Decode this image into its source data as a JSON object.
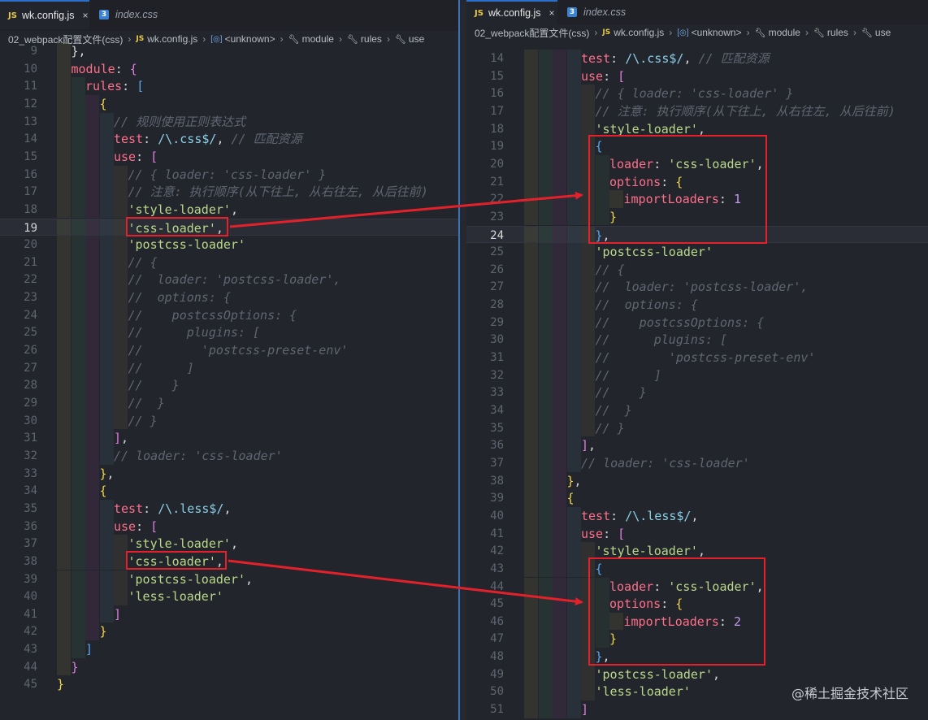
{
  "left": {
    "tabs": [
      {
        "icon": "JS",
        "label": "wk.config.js",
        "active": true,
        "close": "×"
      },
      {
        "icon": "css",
        "label": "index.css",
        "active": false
      }
    ],
    "breadcrumb": [
      "02_webpack配置文件(css)",
      "wk.config.js",
      "<unknown>",
      "module",
      "rules",
      "use"
    ],
    "lines": [
      {
        "n": "9",
        "ind": 1,
        "t": [
          [
            "},",
            "t-p"
          ]
        ]
      },
      {
        "n": "10",
        "ind": 1,
        "t": [
          [
            "module",
            "t-key"
          ],
          [
            ": ",
            "t-p"
          ],
          [
            "{",
            "t-b2"
          ]
        ]
      },
      {
        "n": "11",
        "ind": 2,
        "t": [
          [
            "rules",
            "t-key"
          ],
          [
            ": ",
            "t-p"
          ],
          [
            "[",
            "t-b3"
          ]
        ]
      },
      {
        "n": "12",
        "ind": 3,
        "t": [
          [
            "{",
            "t-b1"
          ]
        ]
      },
      {
        "n": "13",
        "ind": 4,
        "t": [
          [
            "// 规则使用正则表达式",
            "t-cmt"
          ]
        ]
      },
      {
        "n": "14",
        "ind": 4,
        "t": [
          [
            "test",
            "t-key"
          ],
          [
            ": ",
            "t-p"
          ],
          [
            "/\\.css$/",
            "t-reg"
          ],
          [
            ", ",
            "t-p"
          ],
          [
            "// 匹配资源",
            "t-cmt"
          ]
        ]
      },
      {
        "n": "15",
        "ind": 4,
        "t": [
          [
            "use",
            "t-key"
          ],
          [
            ": ",
            "t-p"
          ],
          [
            "[",
            "t-b2"
          ]
        ]
      },
      {
        "n": "16",
        "ind": 5,
        "t": [
          [
            "// { loader: 'css-loader' }",
            "t-cmt"
          ]
        ]
      },
      {
        "n": "17",
        "ind": 5,
        "t": [
          [
            "// 注意: 执行顺序(从下往上, 从右往左, 从后往前)",
            "t-cmt"
          ]
        ]
      },
      {
        "n": "18",
        "ind": 5,
        "t": [
          [
            "'style-loader'",
            "t-str"
          ],
          [
            ",",
            "t-p"
          ]
        ]
      },
      {
        "n": "19",
        "ind": 5,
        "cur": true,
        "t": [
          [
            "'css-loader'",
            "t-str"
          ],
          [
            ",",
            "t-p"
          ]
        ]
      },
      {
        "n": "20",
        "ind": 5,
        "t": [
          [
            "'postcss-loader'",
            "t-str"
          ]
        ]
      },
      {
        "n": "21",
        "ind": 5,
        "t": [
          [
            "// {",
            "t-cmt"
          ]
        ]
      },
      {
        "n": "22",
        "ind": 5,
        "t": [
          [
            "//  loader: 'postcss-loader',",
            "t-cmt"
          ]
        ]
      },
      {
        "n": "23",
        "ind": 5,
        "t": [
          [
            "//  options: {",
            "t-cmt"
          ]
        ]
      },
      {
        "n": "24",
        "ind": 5,
        "t": [
          [
            "//    postcssOptions: {",
            "t-cmt"
          ]
        ]
      },
      {
        "n": "25",
        "ind": 5,
        "t": [
          [
            "//      plugins: [",
            "t-cmt"
          ]
        ]
      },
      {
        "n": "26",
        "ind": 5,
        "t": [
          [
            "//        'postcss-preset-env'",
            "t-cmt"
          ]
        ]
      },
      {
        "n": "27",
        "ind": 5,
        "t": [
          [
            "//      ]",
            "t-cmt"
          ]
        ]
      },
      {
        "n": "28",
        "ind": 5,
        "t": [
          [
            "//    }",
            "t-cmt"
          ]
        ]
      },
      {
        "n": "29",
        "ind": 5,
        "t": [
          [
            "//  }",
            "t-cmt"
          ]
        ]
      },
      {
        "n": "30",
        "ind": 5,
        "t": [
          [
            "// }",
            "t-cmt"
          ]
        ]
      },
      {
        "n": "31",
        "ind": 4,
        "t": [
          [
            "]",
            "t-b2"
          ],
          [
            ",",
            "t-p"
          ]
        ]
      },
      {
        "n": "32",
        "ind": 4,
        "t": [
          [
            "// loader: 'css-loader'",
            "t-cmt"
          ]
        ]
      },
      {
        "n": "33",
        "ind": 3,
        "t": [
          [
            "}",
            "t-b1"
          ],
          [
            ",",
            "t-p"
          ]
        ]
      },
      {
        "n": "34",
        "ind": 3,
        "t": [
          [
            "{",
            "t-b1"
          ]
        ]
      },
      {
        "n": "35",
        "ind": 4,
        "t": [
          [
            "test",
            "t-key"
          ],
          [
            ": ",
            "t-p"
          ],
          [
            "/\\.less$/",
            "t-reg"
          ],
          [
            ",",
            "t-p"
          ]
        ]
      },
      {
        "n": "36",
        "ind": 4,
        "t": [
          [
            "use",
            "t-key"
          ],
          [
            ": ",
            "t-p"
          ],
          [
            "[",
            "t-b2"
          ]
        ]
      },
      {
        "n": "37",
        "ind": 5,
        "t": [
          [
            "'style-loader'",
            "t-str"
          ],
          [
            ",",
            "t-p"
          ]
        ]
      },
      {
        "n": "38",
        "ind": 5,
        "t": [
          [
            "'css-loader'",
            "t-str"
          ],
          [
            ",",
            "t-p"
          ]
        ]
      },
      {
        "n": "39",
        "ind": 5,
        "t": [
          [
            "'postcss-loader'",
            "t-str"
          ],
          [
            ",",
            "t-p"
          ]
        ]
      },
      {
        "n": "40",
        "ind": 5,
        "t": [
          [
            "'less-loader'",
            "t-str"
          ]
        ]
      },
      {
        "n": "41",
        "ind": 4,
        "t": [
          [
            "]",
            "t-b2"
          ]
        ]
      },
      {
        "n": "42",
        "ind": 3,
        "t": [
          [
            "}",
            "t-b1"
          ]
        ]
      },
      {
        "n": "43",
        "ind": 2,
        "t": [
          [
            "]",
            "t-b3"
          ]
        ]
      },
      {
        "n": "44",
        "ind": 1,
        "t": [
          [
            "}",
            "t-b2"
          ]
        ]
      },
      {
        "n": "45",
        "ind": 0,
        "t": [
          [
            "}",
            "t-b1"
          ]
        ]
      }
    ]
  },
  "right": {
    "tabs": [
      {
        "icon": "JS",
        "label": "wk.config.js",
        "active": true,
        "close": "×"
      },
      {
        "icon": "css",
        "label": "index.css",
        "active": false
      }
    ],
    "breadcrumb": [
      "02_webpack配置文件(css)",
      "wk.config.js",
      "<unknown>",
      "module",
      "rules",
      "use"
    ],
    "lines": [
      {
        "n": "14",
        "ind": 4,
        "t": [
          [
            "test",
            "t-key"
          ],
          [
            ": ",
            "t-p"
          ],
          [
            "/\\.css$/",
            "t-reg"
          ],
          [
            ", ",
            "t-p"
          ],
          [
            "// 匹配资源",
            "t-cmt"
          ]
        ]
      },
      {
        "n": "15",
        "ind": 4,
        "t": [
          [
            "use",
            "t-key"
          ],
          [
            ": ",
            "t-p"
          ],
          [
            "[",
            "t-b2"
          ]
        ]
      },
      {
        "n": "16",
        "ind": 5,
        "t": [
          [
            "// { loader: 'css-loader' }",
            "t-cmt"
          ]
        ]
      },
      {
        "n": "17",
        "ind": 5,
        "t": [
          [
            "// 注意: 执行顺序(从下往上, 从右往左, 从后往前)",
            "t-cmt"
          ]
        ]
      },
      {
        "n": "18",
        "ind": 5,
        "t": [
          [
            "'style-loader'",
            "t-str"
          ],
          [
            ",",
            "t-p"
          ]
        ]
      },
      {
        "n": "19",
        "ind": 5,
        "t": [
          [
            "{",
            "t-b3"
          ]
        ]
      },
      {
        "n": "20",
        "ind": 6,
        "t": [
          [
            "loader",
            "t-key"
          ],
          [
            ": ",
            "t-p"
          ],
          [
            "'css-loader'",
            "t-str"
          ],
          [
            ",",
            "t-p"
          ]
        ]
      },
      {
        "n": "21",
        "ind": 6,
        "t": [
          [
            "options",
            "t-key"
          ],
          [
            ": ",
            "t-p"
          ],
          [
            "{",
            "t-b1"
          ]
        ]
      },
      {
        "n": "22",
        "ind": 7,
        "t": [
          [
            "importLoaders",
            "t-key"
          ],
          [
            ": ",
            "t-p"
          ],
          [
            "1",
            "t-num"
          ]
        ]
      },
      {
        "n": "23",
        "ind": 6,
        "t": [
          [
            "}",
            "t-b1"
          ]
        ]
      },
      {
        "n": "24",
        "ind": 5,
        "cur": true,
        "t": [
          [
            "}",
            "t-b3"
          ],
          [
            ",",
            "t-p"
          ]
        ]
      },
      {
        "n": "25",
        "ind": 5,
        "t": [
          [
            "'postcss-loader'",
            "t-str"
          ]
        ]
      },
      {
        "n": "26",
        "ind": 5,
        "t": [
          [
            "// {",
            "t-cmt"
          ]
        ]
      },
      {
        "n": "27",
        "ind": 5,
        "t": [
          [
            "//  loader: 'postcss-loader',",
            "t-cmt"
          ]
        ]
      },
      {
        "n": "28",
        "ind": 5,
        "t": [
          [
            "//  options: {",
            "t-cmt"
          ]
        ]
      },
      {
        "n": "29",
        "ind": 5,
        "t": [
          [
            "//    postcssOptions: {",
            "t-cmt"
          ]
        ]
      },
      {
        "n": "30",
        "ind": 5,
        "t": [
          [
            "//      plugins: [",
            "t-cmt"
          ]
        ]
      },
      {
        "n": "31",
        "ind": 5,
        "t": [
          [
            "//        'postcss-preset-env'",
            "t-cmt"
          ]
        ]
      },
      {
        "n": "32",
        "ind": 5,
        "t": [
          [
            "//      ]",
            "t-cmt"
          ]
        ]
      },
      {
        "n": "33",
        "ind": 5,
        "t": [
          [
            "//    }",
            "t-cmt"
          ]
        ]
      },
      {
        "n": "34",
        "ind": 5,
        "t": [
          [
            "//  }",
            "t-cmt"
          ]
        ]
      },
      {
        "n": "35",
        "ind": 5,
        "t": [
          [
            "// }",
            "t-cmt"
          ]
        ]
      },
      {
        "n": "36",
        "ind": 4,
        "t": [
          [
            "]",
            "t-b2"
          ],
          [
            ",",
            "t-p"
          ]
        ]
      },
      {
        "n": "37",
        "ind": 4,
        "t": [
          [
            "// loader: 'css-loader'",
            "t-cmt"
          ]
        ]
      },
      {
        "n": "38",
        "ind": 3,
        "t": [
          [
            "}",
            "t-b1"
          ],
          [
            ",",
            "t-p"
          ]
        ]
      },
      {
        "n": "39",
        "ind": 3,
        "t": [
          [
            "{",
            "t-b1"
          ]
        ]
      },
      {
        "n": "40",
        "ind": 4,
        "t": [
          [
            "test",
            "t-key"
          ],
          [
            ": ",
            "t-p"
          ],
          [
            "/\\.less$/",
            "t-reg"
          ],
          [
            ",",
            "t-p"
          ]
        ]
      },
      {
        "n": "41",
        "ind": 4,
        "t": [
          [
            "use",
            "t-key"
          ],
          [
            ": ",
            "t-p"
          ],
          [
            "[",
            "t-b2"
          ]
        ]
      },
      {
        "n": "42",
        "ind": 5,
        "t": [
          [
            "'style-loader'",
            "t-str"
          ],
          [
            ",",
            "t-p"
          ]
        ]
      },
      {
        "n": "43",
        "ind": 5,
        "t": [
          [
            "{",
            "t-b3"
          ]
        ]
      },
      {
        "n": "44",
        "ind": 6,
        "t": [
          [
            "loader",
            "t-key"
          ],
          [
            ": ",
            "t-p"
          ],
          [
            "'css-loader'",
            "t-str"
          ],
          [
            ",",
            "t-p"
          ]
        ]
      },
      {
        "n": "45",
        "ind": 6,
        "t": [
          [
            "options",
            "t-key"
          ],
          [
            ": ",
            "t-p"
          ],
          [
            "{",
            "t-b1"
          ]
        ]
      },
      {
        "n": "46",
        "ind": 7,
        "t": [
          [
            "importLoaders",
            "t-key"
          ],
          [
            ": ",
            "t-p"
          ],
          [
            "2",
            "t-num"
          ]
        ]
      },
      {
        "n": "47",
        "ind": 6,
        "t": [
          [
            "}",
            "t-b1"
          ]
        ]
      },
      {
        "n": "48",
        "ind": 5,
        "t": [
          [
            "}",
            "t-b3"
          ],
          [
            ",",
            "t-p"
          ]
        ]
      },
      {
        "n": "49",
        "ind": 5,
        "t": [
          [
            "'postcss-loader'",
            "t-str"
          ],
          [
            ",",
            "t-p"
          ]
        ]
      },
      {
        "n": "50",
        "ind": 5,
        "t": [
          [
            "'less-loader'",
            "t-str"
          ]
        ]
      },
      {
        "n": "51",
        "ind": 4,
        "t": [
          [
            "]",
            "t-b2"
          ]
        ]
      }
    ]
  },
  "watermark": "@稀土掘金技术社区",
  "colors": {
    "highlight_box": "#e4212a",
    "arrow": "#e4212a",
    "active_tab_border": "#2d6fc8"
  }
}
